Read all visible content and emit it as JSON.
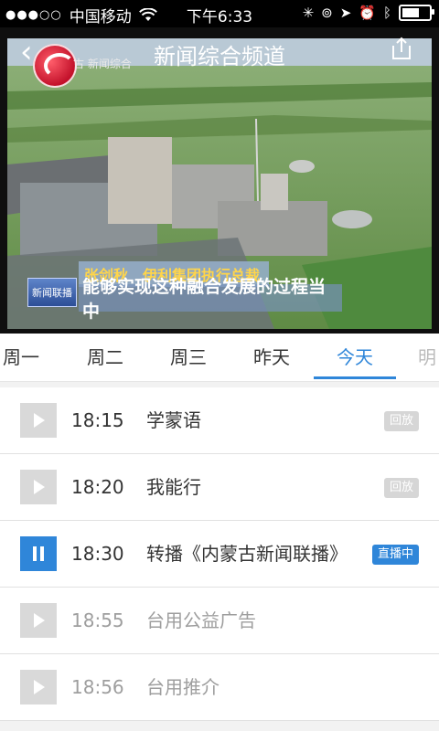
{
  "status_bar": {
    "carrier": "中国移动",
    "time": "下午6:33",
    "signal": "●●●○○",
    "battery_level": 0.75
  },
  "player": {
    "title": "新闻综合频道",
    "channel_logo_text": "古 新闻综合",
    "caption_name": "张剑秋　伊利集团执行总裁",
    "caption_badge": "新闻联播",
    "caption_subtitle": "能够实现这种融合发展的过程当中"
  },
  "tabs": [
    {
      "label": "周一"
    },
    {
      "label": "周二"
    },
    {
      "label": "周三"
    },
    {
      "label": "昨天"
    },
    {
      "label": "今天"
    },
    {
      "label": "明"
    }
  ],
  "active_tab": "今天",
  "colors": {
    "accent": "#2f86d9",
    "replay_badge": "#d6d6d6",
    "dim_text": "#9e9e9e"
  },
  "schedule": [
    {
      "time": "18:15",
      "name": "学蒙语",
      "badge": "回放",
      "state": "replay"
    },
    {
      "time": "18:20",
      "name": "我能行",
      "badge": "回放",
      "state": "replay"
    },
    {
      "time": "18:30",
      "name": "转播《内蒙古新闻联播》",
      "badge": "直播中",
      "state": "live"
    },
    {
      "time": "18:55",
      "name": "台用公益广告",
      "badge": "",
      "state": "upcoming"
    },
    {
      "time": "18:56",
      "name": "台用推介",
      "badge": "",
      "state": "upcoming"
    }
  ]
}
